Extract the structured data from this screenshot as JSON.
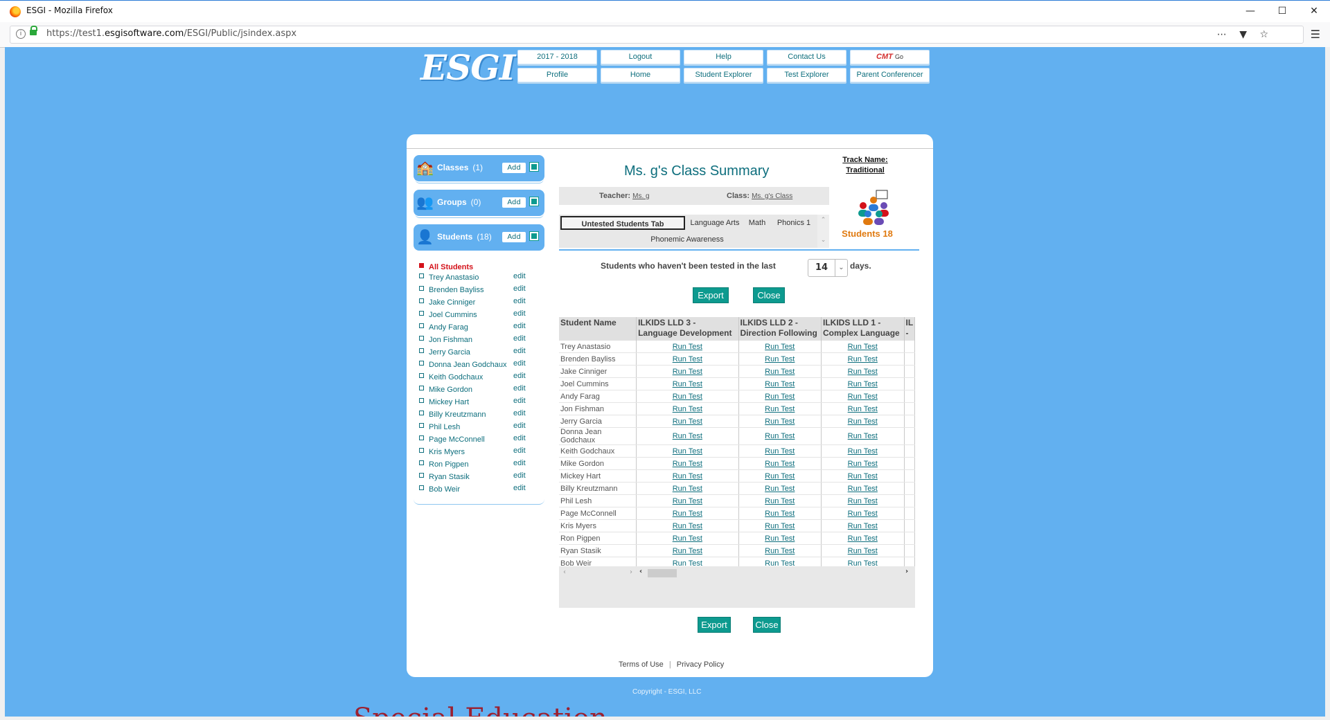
{
  "browser": {
    "title": "ESGI - Mozilla Firefox",
    "url_prefix": "https://test1.",
    "url_domain": "esgisoftware.com",
    "url_path": "/ESGI/Public/jsindex.aspx"
  },
  "logo": "ESGI",
  "nav": {
    "row1": [
      "2017 - 2018",
      "Logout",
      "Help",
      "Contact Us"
    ],
    "cmt_label": "CMT",
    "cmt_go": "Go",
    "row2": [
      "Profile",
      "Home",
      "Student Explorer",
      "Test Explorer",
      "Parent Conferencer"
    ]
  },
  "sidebar": {
    "classes": {
      "label": "Classes",
      "count": "(1)",
      "add": "Add"
    },
    "groups": {
      "label": "Groups",
      "count": "(0)",
      "add": "Add"
    },
    "students": {
      "label": "Students",
      "count": "(18)",
      "add": "Add"
    },
    "all_students": "All Students",
    "edit_label": "edit",
    "students_list": [
      "Trey Anastasio",
      "Brenden Bayliss",
      "Jake Cinniger",
      "Joel Cummins",
      "Andy Farag",
      "Jon Fishman",
      "Jerry Garcia",
      "Donna Jean Godchaux",
      "Keith Godchaux",
      "Mike Gordon",
      "Mickey Hart",
      "Billy Kreutzmann",
      "Phil Lesh",
      "Page McConnell",
      "Kris Myers",
      "Ron Pigpen",
      "Ryan Stasik",
      "Bob Weir"
    ]
  },
  "main": {
    "heading": "Ms. g's Class Summary",
    "track_label": "Track Name:",
    "track_value": "Traditional",
    "students_badge": "Students 18",
    "teacher_label": "Teacher:",
    "teacher_value": "Ms. g",
    "class_label": "Class:",
    "class_value": "Ms. g's Class",
    "tabs": [
      "Untested Students Tab",
      "Language Arts",
      "Math",
      "Phonics 1",
      "Phonemic Awareness"
    ],
    "days_prefix": "Students who haven't been tested in the last",
    "days_value": "14",
    "days_suffix": "days.",
    "export": "Export",
    "close": "Close",
    "table": {
      "headers": [
        "Student Name",
        "ILKIDS LLD 3 - Language Development",
        "ILKIDS LLD 2 - Direction Following",
        "ILKIDS LLD 1 - Complex Language",
        "IL -"
      ],
      "run_label": "Run Test"
    }
  },
  "footer": {
    "terms": "Terms of Use",
    "sep": "|",
    "privacy": "Privacy Policy",
    "copyright": "Copyright - ESGI, LLC"
  },
  "background_text": "Special Education",
  "colors": {
    "page_bg": "#62b0f0",
    "accent": "#0d9a8f",
    "link": "#0d6e7d",
    "alert": "#d4121a",
    "badge": "#e07a10"
  }
}
